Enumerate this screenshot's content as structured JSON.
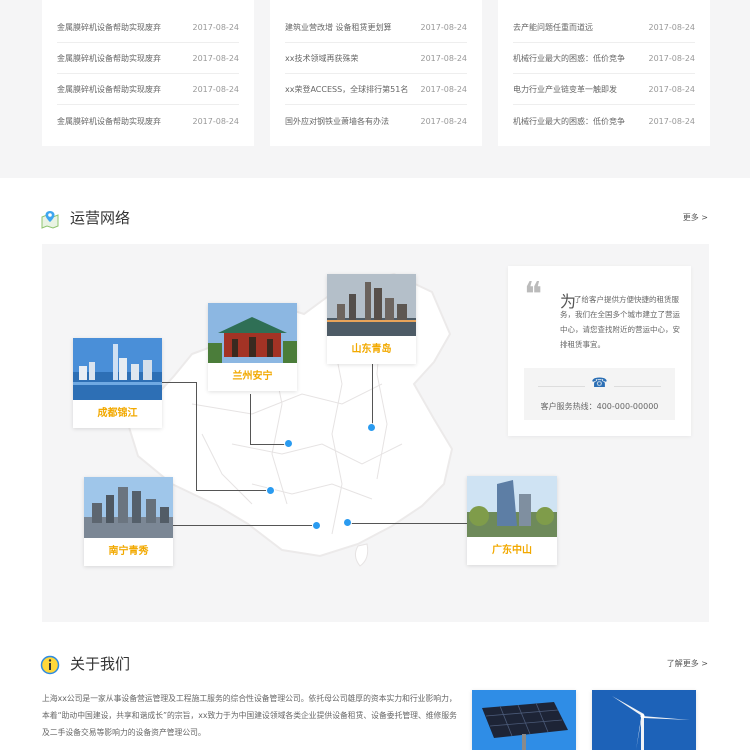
{
  "news_columns": [
    {
      "rows": [
        {
          "title": "金属膜碎机设备帮助实现废弃",
          "date": "2017-08-24"
        },
        {
          "title": "金属膜碎机设备帮助实现废弃",
          "date": "2017-08-24"
        },
        {
          "title": "金属膜碎机设备帮助实现废弃",
          "date": "2017-08-24"
        },
        {
          "title": "金属膜碎机设备帮助实现废弃",
          "date": "2017-08-24"
        }
      ]
    },
    {
      "rows": [
        {
          "title": "建筑业营改增 设备租赁更划算",
          "date": "2017-08-24"
        },
        {
          "title": "xx技术领域再获殊荣",
          "date": "2017-08-24"
        },
        {
          "title": "xx荣登ACCESS，全球排行第51名",
          "date": "2017-08-24"
        },
        {
          "title": "国外应对钢铁业萧墙各有办法",
          "date": "2017-08-24"
        }
      ]
    },
    {
      "rows": [
        {
          "title": "去产能问题任重而道远",
          "date": "2017-08-24"
        },
        {
          "title": "机械行业最大的困惑：低价竞争",
          "date": "2017-08-24"
        },
        {
          "title": "电力行业产业链变革一触即发",
          "date": "2017-08-24"
        },
        {
          "title": "机械行业最大的困惑：低价竞争",
          "date": "2017-08-24"
        }
      ]
    }
  ],
  "network": {
    "title": "运营网络",
    "more": "更多 >",
    "cities": {
      "chengdu": "成都锦江",
      "lanzhou": "兰州安宁",
      "shandong": "山东青岛",
      "nanning": "南宁青秀",
      "guangdong": "广东中山"
    },
    "quote_big": "为",
    "quote_text": "了给客户提供方便快捷的租赁服务，我们在全国多个城市建立了营运中心，请您查找附近的营运中心，安排租赁事宜。",
    "hotline": "客户服务热线：400-000-00000"
  },
  "about": {
    "title": "关于我们",
    "more": "了解更多 >",
    "text": "上海xx公司是一家从事设备营运管理及工程施工服务的综合性设备管理公司。依托母公司雄厚的资本实力和行业影响力，本着“助动中国建设，共享和谐成长”的宗旨，xx致力于为中国建设领域各类企业提供设备租赁、设备委托管理、维修服务及二手设备交易等影响力的设备资产管理公司。"
  },
  "colors": {
    "accent_blue": "#2a9bf0",
    "city_caption": "#f2a900",
    "page_bg": "#f5f5f6"
  }
}
